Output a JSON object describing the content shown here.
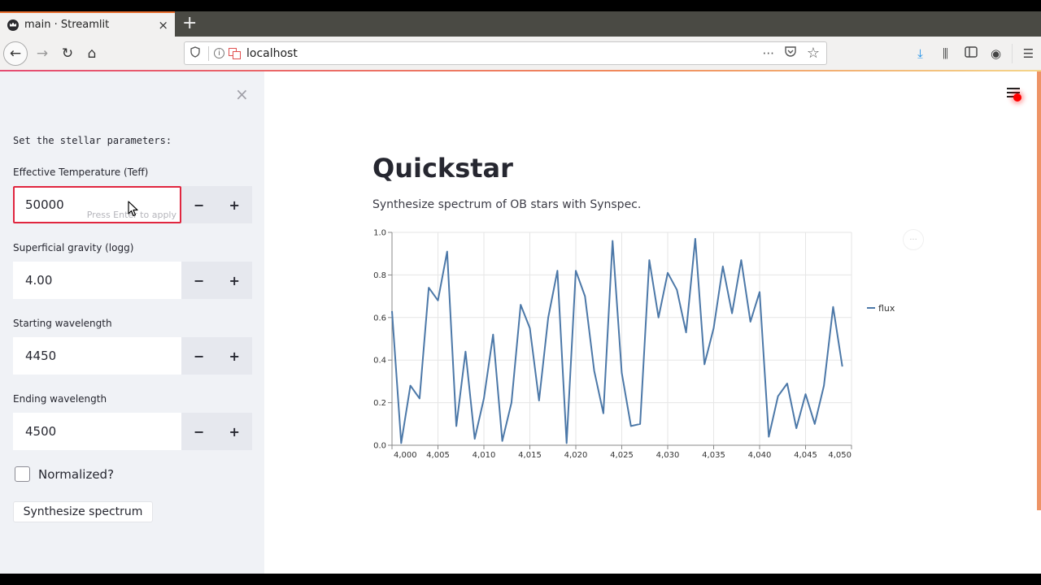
{
  "browser": {
    "tab_title": "main · Streamlit",
    "tab_close": "×",
    "new_tab": "+",
    "url": "localhost",
    "url_actions": [
      "···",
      "pocket-icon",
      "star-icon"
    ],
    "icons": {
      "back": "←",
      "forward": "→",
      "reload": "↻",
      "home": "⌂",
      "shield": "🛡",
      "info": "i",
      "more": "···",
      "pocket": "♡",
      "star": "☆",
      "download": "⤓",
      "library": "⫼",
      "sidebar": "▯",
      "account": "◉",
      "menu": "☰"
    }
  },
  "sidebar": {
    "close": "×",
    "intro": "Set the stellar parameters:",
    "fields": [
      {
        "label": "Effective Temperature (Teff)",
        "value": "50000",
        "hint": "Press Enter to apply",
        "focused": true
      },
      {
        "label": "Superficial gravity (logg)",
        "value": "4.00"
      },
      {
        "label": "Starting wavelength",
        "value": "4450"
      },
      {
        "label": "Ending wavelength",
        "value": "4500"
      }
    ],
    "minus": "−",
    "plus": "+",
    "checkbox": {
      "label": "Normalized?",
      "checked": false
    },
    "button": "Synthesize spectrum"
  },
  "main": {
    "title": "Quickstar",
    "subtitle": "Synthesize spectrum of OB stars with Synspec.",
    "chart_more": "···"
  },
  "chart_data": {
    "type": "line",
    "title": "",
    "xlabel": "",
    "ylabel": "",
    "xlim": [
      4000,
      4050
    ],
    "ylim": [
      0,
      1.0
    ],
    "grid": true,
    "legend": {
      "placement": "right",
      "entries": [
        "flux"
      ]
    },
    "line_color": "#4c78a8",
    "x_ticks": [
      "4,000",
      "4,005",
      "4,010",
      "4,015",
      "4,020",
      "4,025",
      "4,030",
      "4,035",
      "4,040",
      "4,045",
      "4,050"
    ],
    "y_ticks": [
      "0.0",
      "0.2",
      "0.4",
      "0.6",
      "0.8",
      "1.0"
    ],
    "series": [
      {
        "name": "flux",
        "x": [
          4000,
          4001,
          4002,
          4003,
          4004,
          4005,
          4006,
          4007,
          4008,
          4009,
          4010,
          4011,
          4012,
          4013,
          4014,
          4015,
          4016,
          4017,
          4018,
          4019,
          4020,
          4021,
          4022,
          4023,
          4024,
          4025,
          4026,
          4027,
          4028,
          4029,
          4030,
          4031,
          4032,
          4033,
          4034,
          4035,
          4036,
          4037,
          4038,
          4039,
          4040,
          4041,
          4042,
          4043,
          4044,
          4045,
          4046,
          4047,
          4048,
          4049
        ],
        "values": [
          0.63,
          0.01,
          0.28,
          0.22,
          0.74,
          0.68,
          0.91,
          0.09,
          0.44,
          0.03,
          0.22,
          0.52,
          0.02,
          0.2,
          0.66,
          0.55,
          0.21,
          0.6,
          0.82,
          0.01,
          0.82,
          0.7,
          0.35,
          0.15,
          0.96,
          0.34,
          0.09,
          0.1,
          0.87,
          0.6,
          0.81,
          0.73,
          0.53,
          0.97,
          0.38,
          0.55,
          0.84,
          0.62,
          0.87,
          0.58,
          0.72,
          0.04,
          0.23,
          0.29,
          0.08,
          0.24,
          0.1,
          0.28,
          0.65,
          0.37
        ]
      }
    ]
  }
}
